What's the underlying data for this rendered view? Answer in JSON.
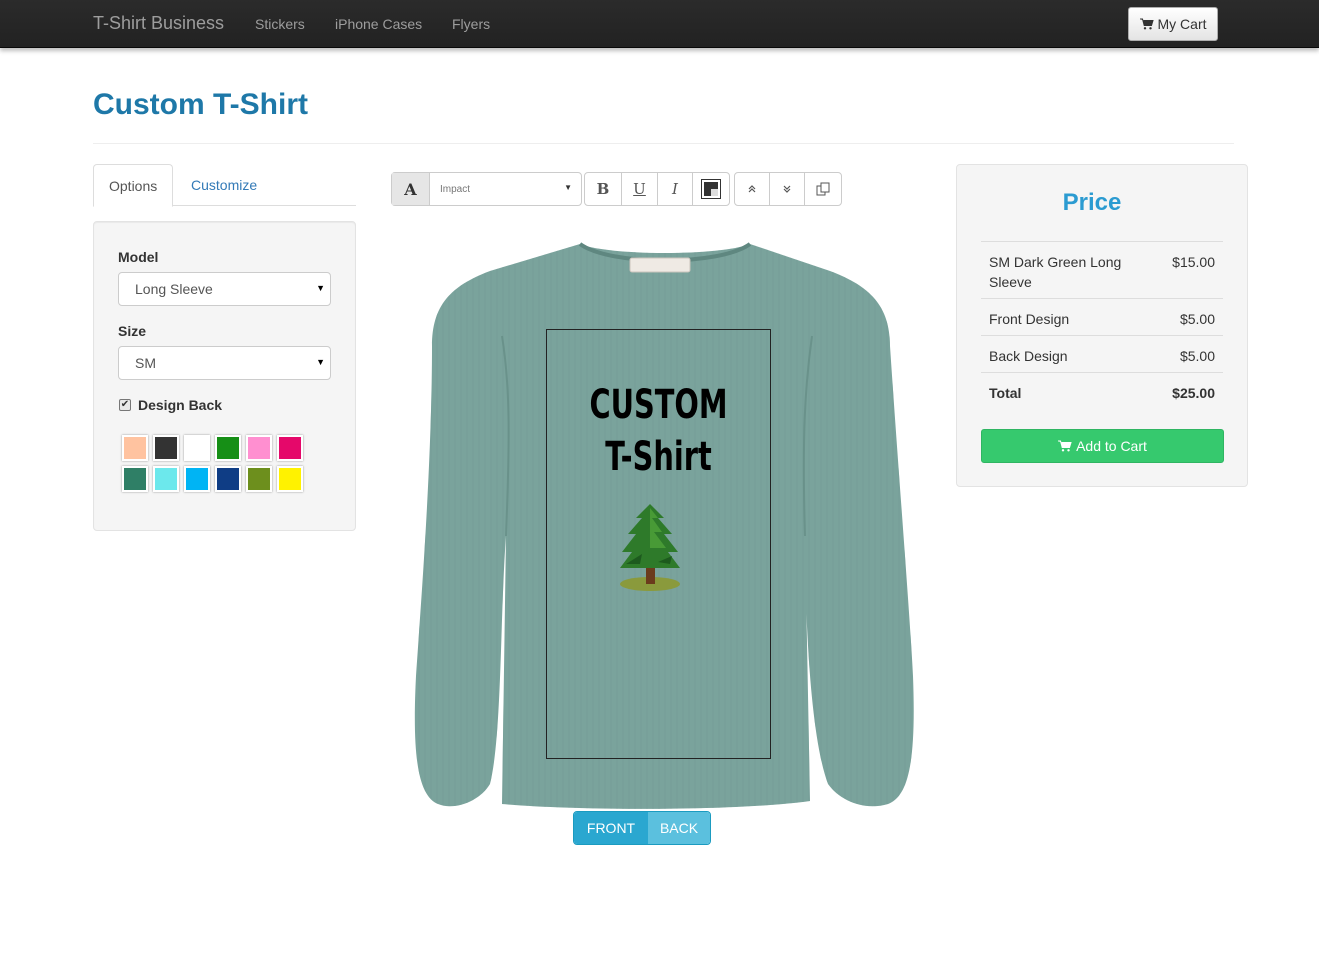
{
  "nav": {
    "brand": "T-Shirt Business",
    "links": [
      "Stickers",
      "iPhone Cases",
      "Flyers"
    ],
    "cart_label": "My Cart"
  },
  "page": {
    "title": "Custom T-Shirt"
  },
  "tabs": [
    "Options",
    "Customize"
  ],
  "options": {
    "model_label": "Model",
    "model_value": "Long Sleeve",
    "size_label": "Size",
    "size_value": "SM",
    "design_back_label": "Design Back",
    "design_back_checked": true,
    "swatch_colors": [
      "#ffc3a0",
      "#333333",
      "#ffffff",
      "#168f16",
      "#ff8fd0",
      "#e5086a",
      "#2f7f66",
      "#6ce8ec",
      "#00b4f4",
      "#0f3d85",
      "#6d8f1d",
      "#fff200"
    ]
  },
  "toolbar": {
    "font_icon": "font-icon",
    "font_name": "Impact",
    "bold": "B",
    "underline": "U",
    "italic": "I"
  },
  "design": {
    "line1": "CUSTOM",
    "line2": "T-Shirt",
    "shirt_color": "#7aa39c"
  },
  "view_toggle": {
    "front": "FRONT",
    "back": "BACK",
    "active": "FRONT"
  },
  "price": {
    "title": "Price",
    "rows": [
      {
        "name": "SM Dark Green Long Sleeve",
        "value": "$15.00"
      },
      {
        "name": "Front Design",
        "value": "$5.00"
      },
      {
        "name": "Back Design",
        "value": "$5.00"
      }
    ],
    "total_label": "Total",
    "total_value": "$25.00",
    "add_to_cart": "Add to Cart"
  }
}
